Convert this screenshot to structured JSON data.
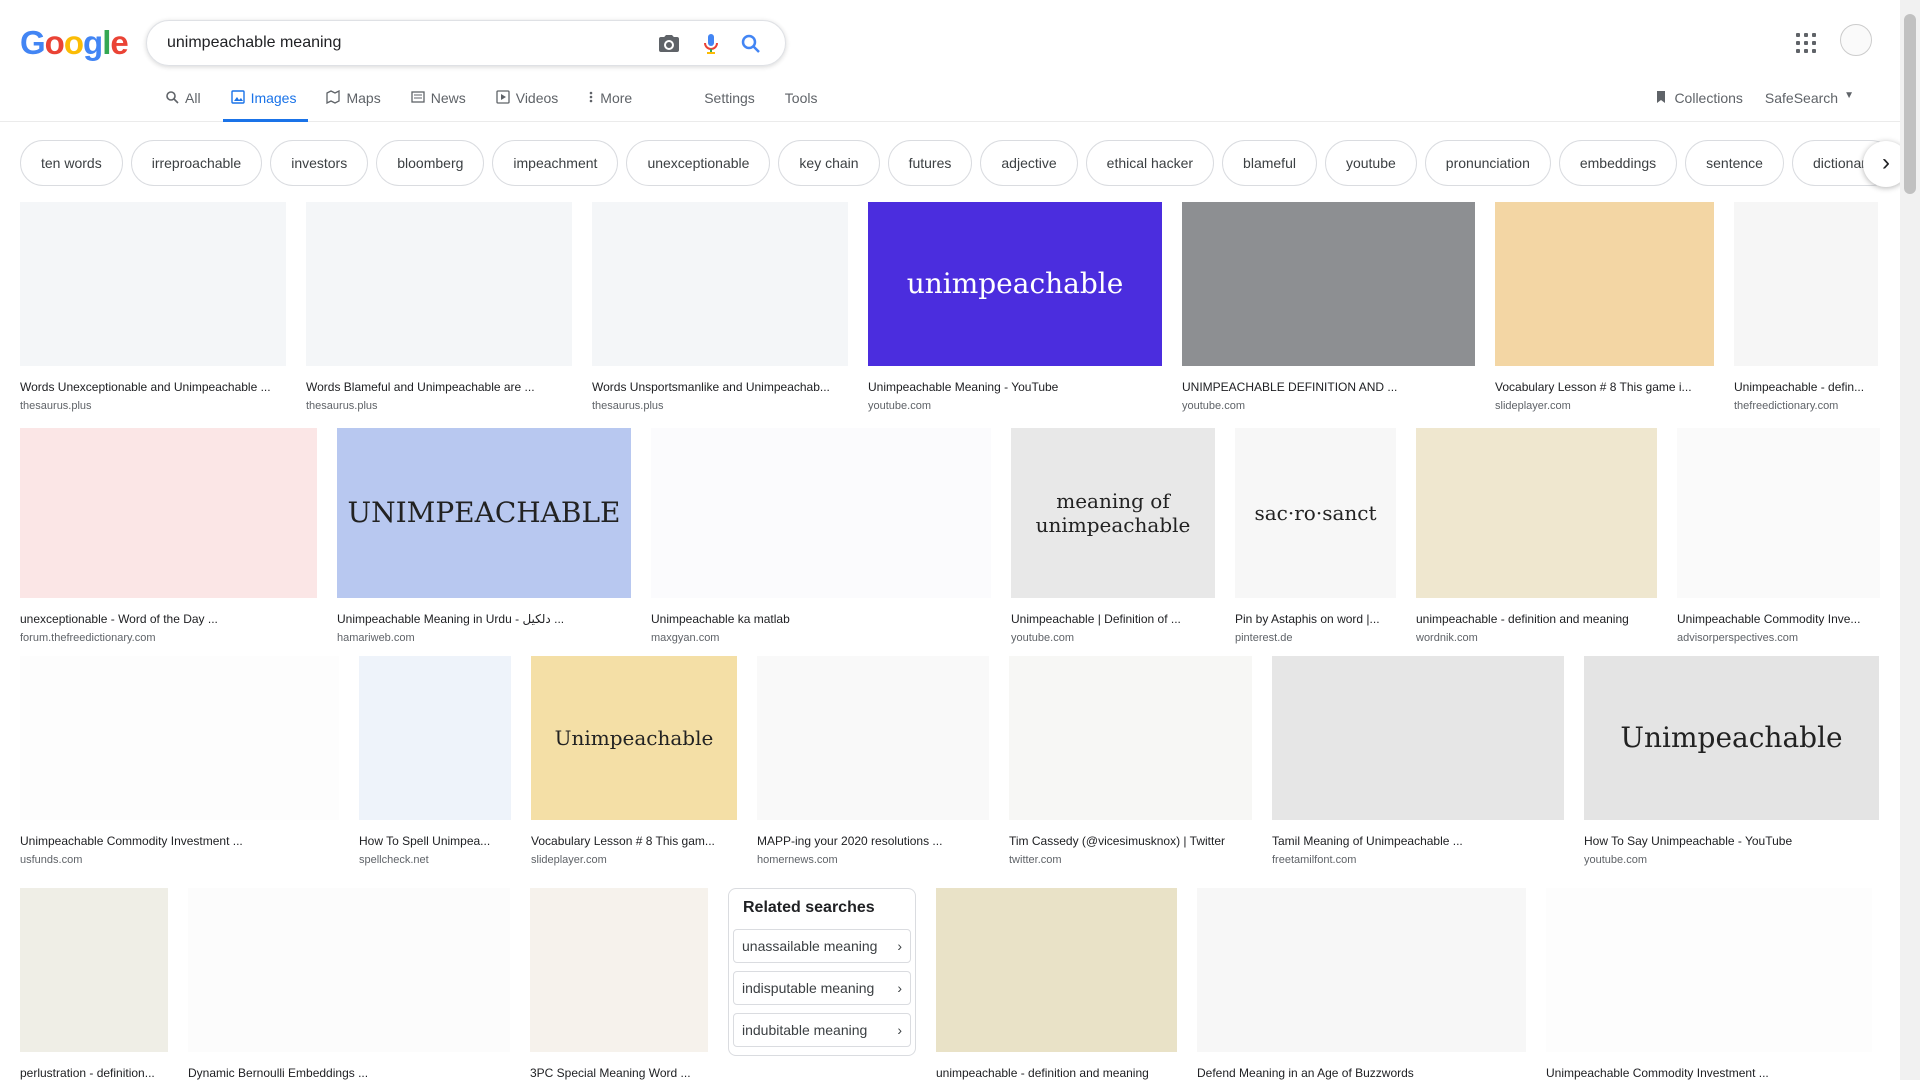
{
  "logo": "Google",
  "search": {
    "query": "unimpeachable meaning"
  },
  "tabs": [
    {
      "label": "All",
      "icon": "search-icon"
    },
    {
      "label": "Images",
      "icon": "image-icon",
      "active": true
    },
    {
      "label": "Maps",
      "icon": "map-icon"
    },
    {
      "label": "News",
      "icon": "news-icon"
    },
    {
      "label": "Videos",
      "icon": "video-icon"
    },
    {
      "label": "More",
      "icon": "more-vert-icon"
    },
    {
      "label": "Settings"
    },
    {
      "label": "Tools"
    }
  ],
  "right_tools": {
    "collections": "Collections",
    "safesearch": "SafeSearch"
  },
  "chips": [
    "ten words",
    "irreproachable",
    "investors",
    "bloomberg",
    "impeachment",
    "unexceptionable",
    "key chain",
    "futures",
    "adjective",
    "ethical hacker",
    "blameful",
    "youtube",
    "pronunciation",
    "embeddings",
    "sentence",
    "dictionary"
  ],
  "rows": [
    [
      {
        "title": "Words Unexceptionable and Unimpeachable ...",
        "source": "thesaurus.plus",
        "w": 266,
        "color": "#f4f6f8"
      },
      {
        "title": "Words Blameful and Unimpeachable are ...",
        "source": "thesaurus.plus",
        "w": 266,
        "color": "#f4f6f8"
      },
      {
        "title": "Words Unsportsmanlike and Unimpeachab...",
        "source": "thesaurus.plus",
        "w": 256,
        "color": "#f4f6f8"
      },
      {
        "title": "Unimpeachable Meaning - YouTube",
        "source": "youtube.com",
        "w": 294,
        "color": "#4b2dde",
        "text": "unimpeachable"
      },
      {
        "title": "UNIMPEACHABLE DEFINITION AND ...",
        "source": "youtube.com",
        "w": 293,
        "color": "#8d8f92"
      },
      {
        "title": "Vocabulary Lesson # 8 This game i...",
        "source": "slideplayer.com",
        "w": 219,
        "color": "#f3d6a4"
      },
      {
        "title": "Unimpeachable - defin...",
        "source": "thefreedictionary.com",
        "w": 144,
        "color": "#f6f6f6"
      }
    ],
    [
      {
        "title": "unexceptionable - Word of the Day ...",
        "source": "forum.thefreedictionary.com",
        "w": 297,
        "color": "#fbe6e6"
      },
      {
        "title": "Unimpeachable Meaning in Urdu - دلکیل ...",
        "source": "hamariweb.com",
        "w": 294,
        "color": "#b8c8f0",
        "text": "UNIMPEACHABLE"
      },
      {
        "title": "Unimpeachable ka matlab",
        "source": "maxgyan.com",
        "w": 340,
        "color": "#fbfbfd"
      },
      {
        "title": "Unimpeachable | Definition of ...",
        "source": "youtube.com",
        "w": 204,
        "color": "#e8e8e8",
        "text": "meaning of unimpeachable"
      },
      {
        "title": "Pin by Astaphis on word |...",
        "source": "pinterest.de",
        "w": 161,
        "color": "#f7f7f7",
        "text": "sac·ro·sanct"
      },
      {
        "title": "unimpeachable - definition and meaning",
        "source": "wordnik.com",
        "w": 241,
        "color": "#efe7cf"
      },
      {
        "title": "Unimpeachable Commodity Inve...",
        "source": "advisorperspectives.com",
        "w": 203,
        "color": "#fafafa"
      }
    ],
    [
      {
        "title": "Unimpeachable Commodity Investment ...",
        "source": "usfunds.com",
        "w": 319,
        "color": "#fdfdfd"
      },
      {
        "title": "How To Spell Unimpea...",
        "source": "spellcheck.net",
        "w": 152,
        "color": "#eef3fa"
      },
      {
        "title": "Vocabulary Lesson # 8 This gam...",
        "source": "slideplayer.com",
        "w": 206,
        "color": "#f4dfa6",
        "text": "Unimpeachable"
      },
      {
        "title": "MAPP-ing your 2020 resolutions ...",
        "source": "homernews.com",
        "w": 232,
        "color": "#f9f9f9"
      },
      {
        "title": "Tim Cassedy (@vicesimusknox) | Twitter",
        "source": "twitter.com",
        "w": 243,
        "color": "#f7f7f5"
      },
      {
        "title": "Tamil Meaning of Unimpeachable ...",
        "source": "freetamilfont.com",
        "w": 292,
        "color": "#e6e6e6"
      },
      {
        "title": "How To Say Unimpeachable - YouTube",
        "source": "youtube.com",
        "w": 295,
        "color": "#e4e4e4",
        "text": "Unimpeachable"
      }
    ],
    [
      {
        "title": "perlustration - definition...",
        "source": "",
        "w": 148,
        "color": "#efeee6"
      },
      {
        "title": "Dynamic Bernoulli Embeddings ...",
        "source": "",
        "w": 322,
        "color": "#fcfcfc"
      },
      {
        "title": "3PC Special Meaning Word ...",
        "source": "",
        "w": 178,
        "color": "#f6f2ec"
      },
      {
        "related": true,
        "w": 188
      },
      {
        "title": "unimpeachable - definition and meaning",
        "source": "",
        "w": 241,
        "color": "#e9e2c7"
      },
      {
        "title": "Defend Meaning in an Age of Buzzwords",
        "source": "",
        "w": 329,
        "color": "#f7f7f7"
      },
      {
        "title": "Unimpeachable Commodity Investment ...",
        "source": "",
        "w": 326,
        "color": "#fdfdfd"
      }
    ]
  ],
  "related": {
    "title": "Related searches",
    "items": [
      "unassailable meaning",
      "indisputable meaning",
      "indubitable meaning"
    ]
  }
}
